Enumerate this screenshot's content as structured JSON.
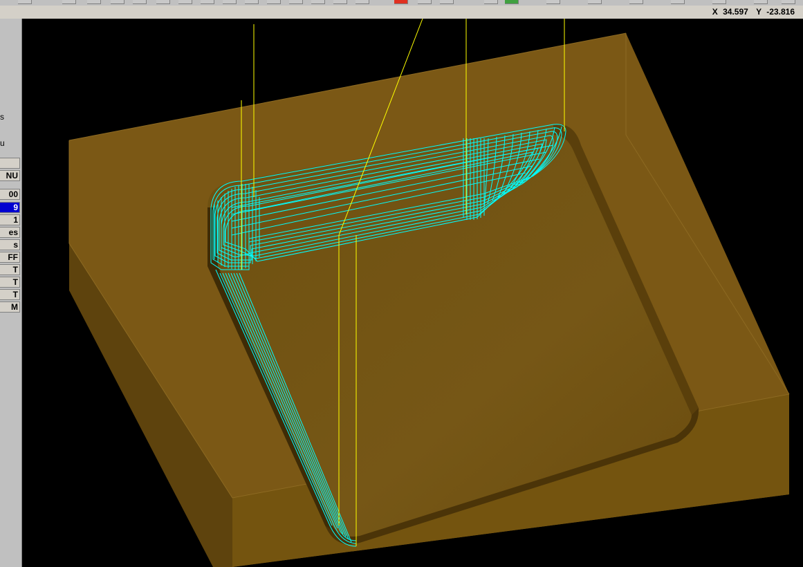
{
  "status": {
    "x_label": "X",
    "x_value": "34.597",
    "y_label": "Y",
    "y_value": "-23.816"
  },
  "left_panel": {
    "texts": [
      "s",
      "u"
    ],
    "buttons": [
      "",
      "NU",
      "00",
      "9",
      "1",
      "es",
      "s",
      "FF",
      "T",
      "T",
      "T",
      "M"
    ],
    "selected_index": 3
  },
  "colors": {
    "stock": "#7a5714",
    "toolpath": "#00ffff",
    "rapid": "#ffff00",
    "panel": "#c0c0c0",
    "selected": "#0000d0"
  }
}
